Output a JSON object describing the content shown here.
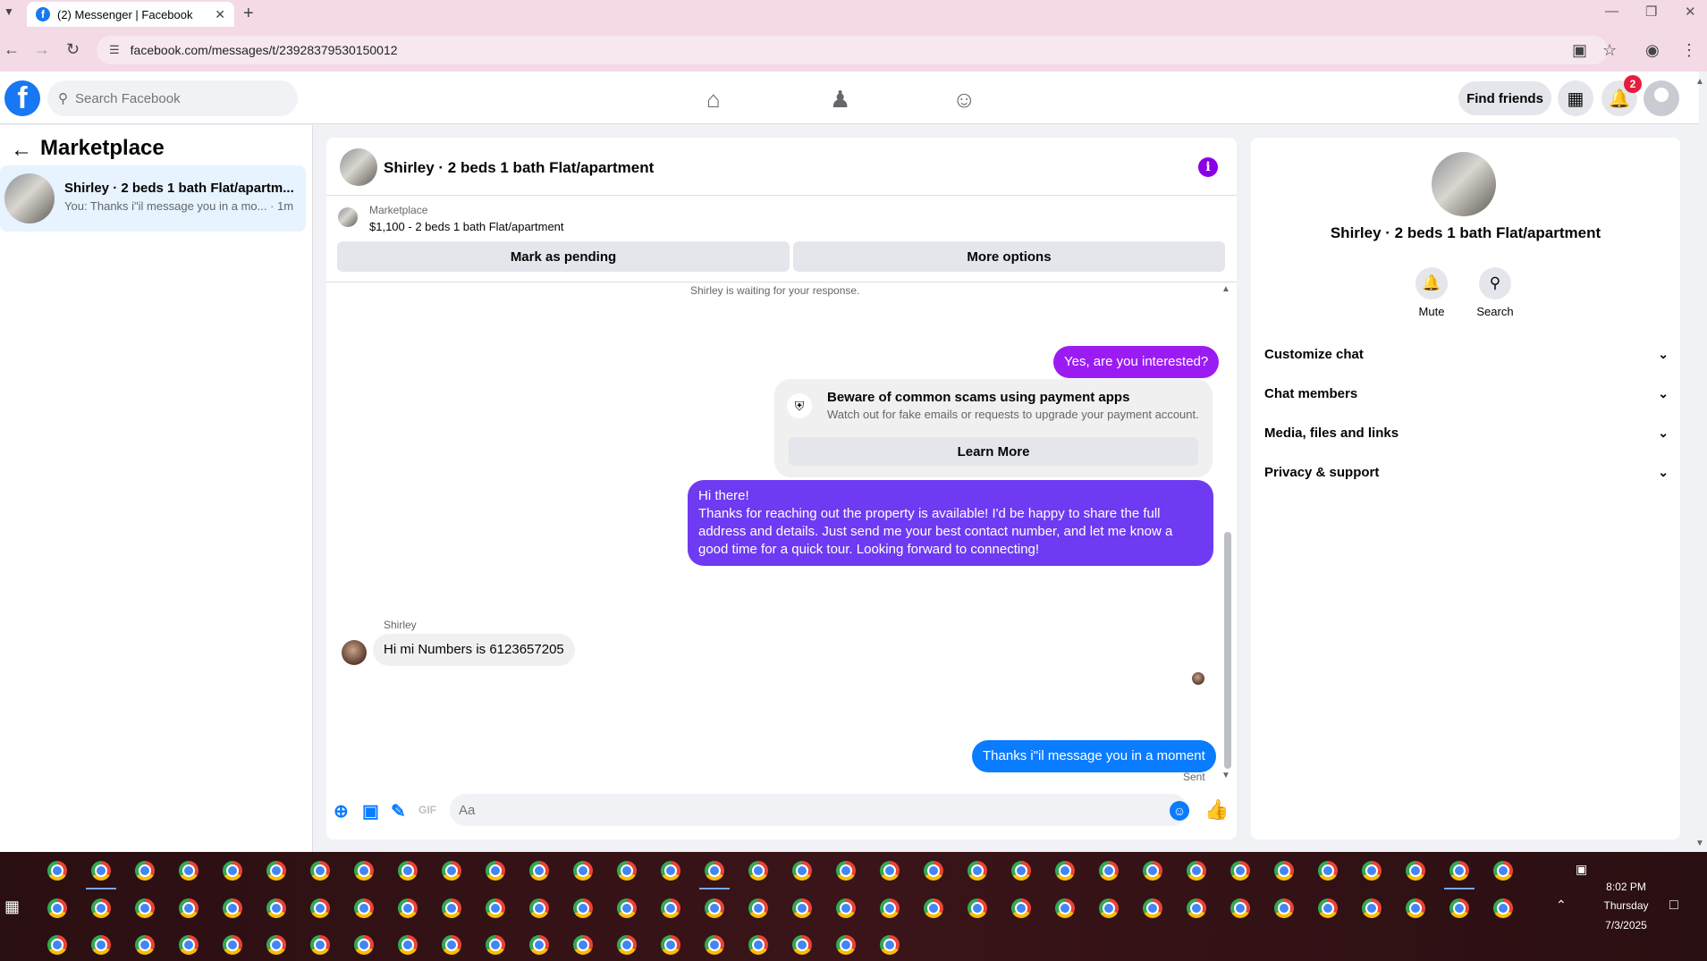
{
  "browser": {
    "tab_title": "(2) Messenger | Facebook",
    "url": "facebook.com/messages/t/23928379530150012"
  },
  "fb_header": {
    "search_placeholder": "Search Facebook",
    "find_friends_label": "Find friends",
    "notification_count": "2"
  },
  "sidebar": {
    "title": "Marketplace",
    "conversations": [
      {
        "name": "Shirley · 2 beds 1 bath Flat/apartm...",
        "snippet": "You: Thanks i\"il message you in a mo... · 1m"
      }
    ]
  },
  "chat": {
    "title": "Shirley · 2 beds 1 bath Flat/apartment",
    "marketplace_label": "Marketplace",
    "listing": "$1,100 - 2 beds 1 bath Flat/apartment",
    "mark_pending_label": "Mark as pending",
    "more_options_label": "More options",
    "waiting_text": "Shirley is waiting for your response.",
    "messages": {
      "msg1": "Yes, are you interested?",
      "scam_title": "Beware of common scams using payment apps",
      "scam_subtitle": "Watch out for fake emails or requests to upgrade your payment account.",
      "learn_more_label": "Learn More",
      "msg2": "Hi there!\nThanks for reaching out the property is available! I'd be happy to share the full address and details. Just send me your best contact number, and let me know a good time for a quick tour. Looking forward to connecting!",
      "sender_name": "Shirley",
      "msg3": "Hi mi Numbers is 6123657205",
      "msg4": "Thanks i\"il message you in a moment",
      "sent_label": "Sent"
    },
    "composer_placeholder": "Aa"
  },
  "right_panel": {
    "name": "Shirley · 2 beds 1 bath Flat/apartment",
    "mute_label": "Mute",
    "search_label": "Search",
    "sections": [
      "Customize chat",
      "Chat members",
      "Media, files and links",
      "Privacy & support"
    ]
  },
  "taskbar": {
    "time": "8:02 PM",
    "day": "Thursday",
    "date": "7/3/2025"
  },
  "colors": {
    "fb_blue": "#1877f2",
    "messenger_purple": "#9b1cf3",
    "messenger_violet": "#6e3af2",
    "messenger_blue": "#0a7cff",
    "notification_red": "#e41e3f"
  }
}
